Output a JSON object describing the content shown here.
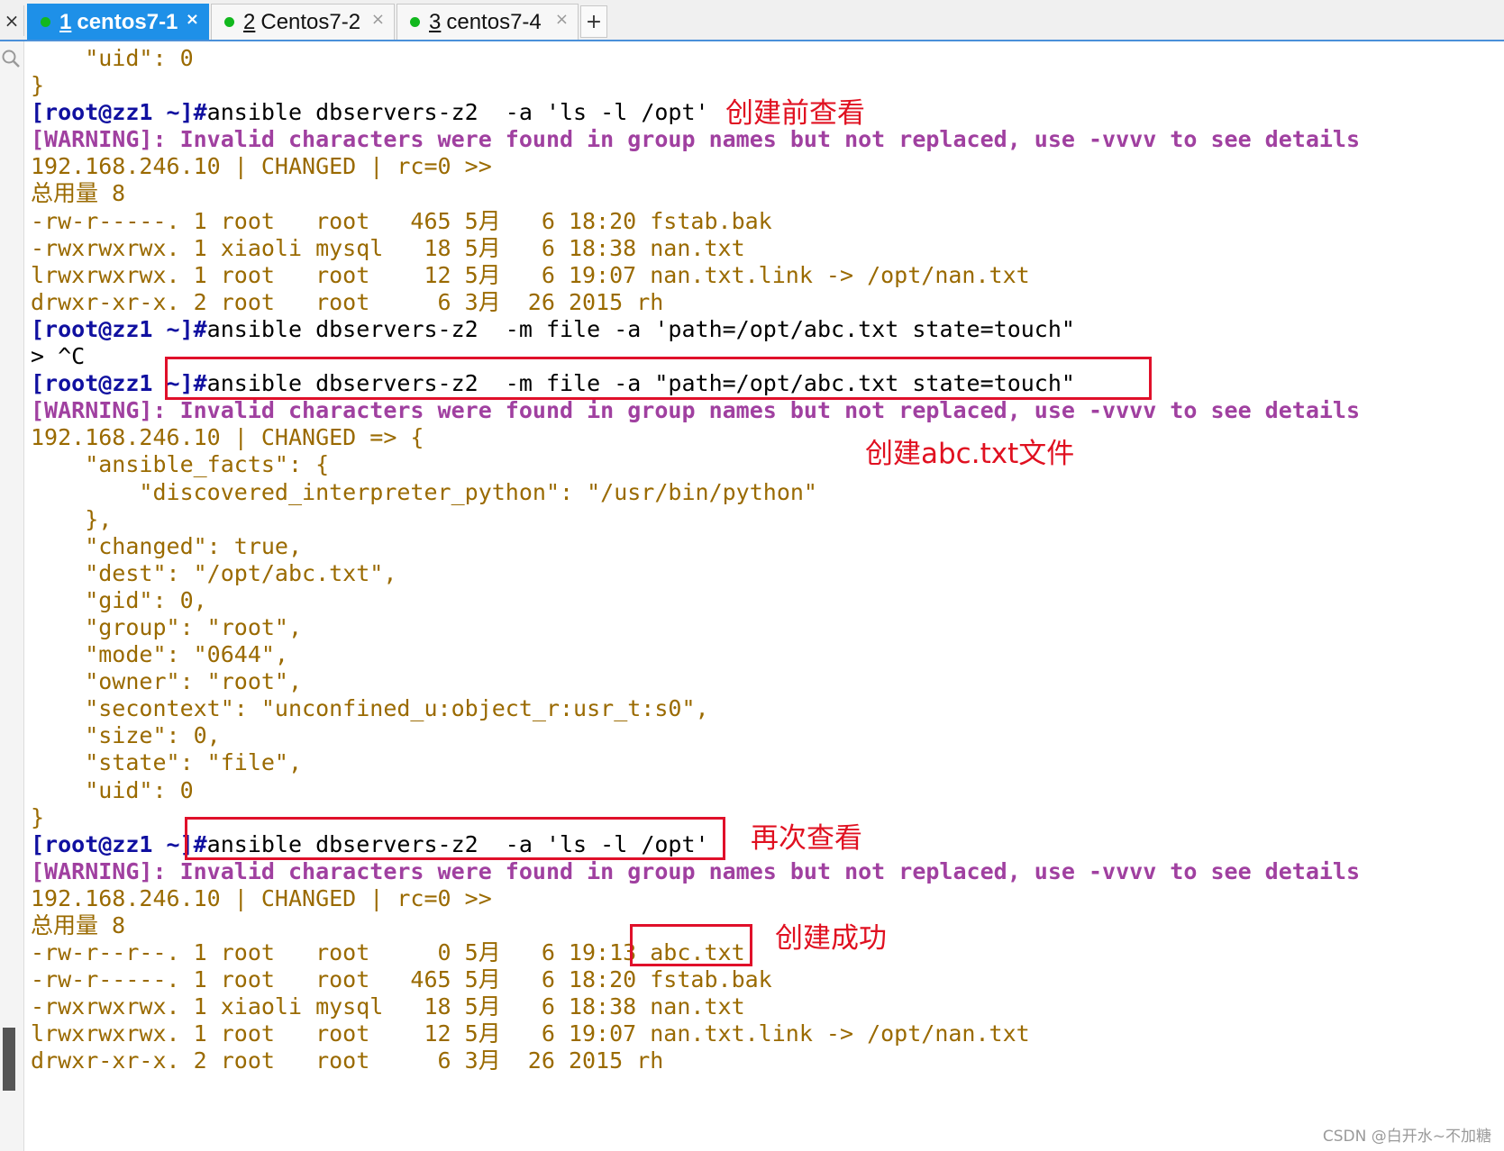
{
  "tabs": [
    {
      "num": "1",
      "label": "centos7-1",
      "active": true
    },
    {
      "num": "2",
      "label": "Centos7-2",
      "active": false
    },
    {
      "num": "3",
      "label": "centos7-4",
      "active": false
    }
  ],
  "tab_close_glyph": "×",
  "tab_add_glyph": "+",
  "left_close_glyph": "×",
  "colors": {
    "prompt": "#1010a0",
    "warning": "#a040a0",
    "output": "#9a6a00",
    "annotation": "#e0102a",
    "tab_active": "#1e90e8",
    "status_dot": "#12b81e"
  },
  "terminal": {
    "lines": [
      {
        "kind": "output",
        "text": "    \"uid\": 0"
      },
      {
        "kind": "output",
        "text": "}"
      },
      {
        "kind": "command",
        "prompt": "[root@zz1 ~]#",
        "text": "ansible dbservers-z2  -a 'ls -l /opt'"
      },
      {
        "kind": "warning",
        "text": "[WARNING]: Invalid characters were found in group names but not replaced, use -vvvv to see details"
      },
      {
        "kind": "output",
        "text": "192.168.246.10 | CHANGED | rc=0 >>"
      },
      {
        "kind": "output",
        "text": "总用量 8"
      },
      {
        "kind": "output",
        "text": "-rw-r-----. 1 root   root   465 5月   6 18:20 fstab.bak"
      },
      {
        "kind": "output",
        "text": "-rwxrwxrwx. 1 xiaoli mysql   18 5月   6 18:38 nan.txt"
      },
      {
        "kind": "output",
        "text": "lrwxrwxrwx. 1 root   root    12 5月   6 19:07 nan.txt.link -> /opt/nan.txt"
      },
      {
        "kind": "output",
        "text": "drwxr-xr-x. 2 root   root     6 3月  26 2015 rh"
      },
      {
        "kind": "command",
        "prompt": "[root@zz1 ~]#",
        "text": "ansible dbservers-z2  -m file -a 'path=/opt/abc.txt state=touch\""
      },
      {
        "kind": "plain",
        "text": "> ^C"
      },
      {
        "kind": "command",
        "prompt": "[root@zz1 ~]#",
        "text": "ansible dbservers-z2  -m file -a \"path=/opt/abc.txt state=touch\""
      },
      {
        "kind": "warning",
        "text": "[WARNING]: Invalid characters were found in group names but not replaced, use -vvvv to see details"
      },
      {
        "kind": "output",
        "text": "192.168.246.10 | CHANGED => {"
      },
      {
        "kind": "output",
        "text": "    \"ansible_facts\": {"
      },
      {
        "kind": "output",
        "text": "        \"discovered_interpreter_python\": \"/usr/bin/python\""
      },
      {
        "kind": "output",
        "text": "    },"
      },
      {
        "kind": "output",
        "text": "    \"changed\": true,"
      },
      {
        "kind": "output",
        "text": "    \"dest\": \"/opt/abc.txt\","
      },
      {
        "kind": "output",
        "text": "    \"gid\": 0,"
      },
      {
        "kind": "output",
        "text": "    \"group\": \"root\","
      },
      {
        "kind": "output",
        "text": "    \"mode\": \"0644\","
      },
      {
        "kind": "output",
        "text": "    \"owner\": \"root\","
      },
      {
        "kind": "output",
        "text": "    \"secontext\": \"unconfined_u:object_r:usr_t:s0\","
      },
      {
        "kind": "output",
        "text": "    \"size\": 0,"
      },
      {
        "kind": "output",
        "text": "    \"state\": \"file\","
      },
      {
        "kind": "output",
        "text": "    \"uid\": 0"
      },
      {
        "kind": "output",
        "text": "}"
      },
      {
        "kind": "command",
        "prompt": "[root@zz1 ~]#",
        "text": "ansible dbservers-z2  -a 'ls -l /opt'"
      },
      {
        "kind": "warning",
        "text": "[WARNING]: Invalid characters were found in group names but not replaced, use -vvvv to see details"
      },
      {
        "kind": "output",
        "text": "192.168.246.10 | CHANGED | rc=0 >>"
      },
      {
        "kind": "output",
        "text": "总用量 8"
      },
      {
        "kind": "output",
        "text": "-rw-r--r--. 1 root   root     0 5月   6 19:13 abc.txt"
      },
      {
        "kind": "output",
        "text": "-rw-r-----. 1 root   root   465 5月   6 18:20 fstab.bak"
      },
      {
        "kind": "output",
        "text": "-rwxrwxrwx. 1 xiaoli mysql   18 5月   6 18:38 nan.txt"
      },
      {
        "kind": "output",
        "text": "lrwxrwxrwx. 1 root   root    12 5月   6 19:07 nan.txt.link -> /opt/nan.txt"
      },
      {
        "kind": "output",
        "text": "drwxr-xr-x. 2 root   root     6 3月  26 2015 rh"
      }
    ]
  },
  "annotations": {
    "before_check": "创建前查看",
    "create_file": "创建abc.txt文件",
    "check_again": "再次查看",
    "success": "创建成功"
  },
  "watermark": "CSDN @白开水~不加糖"
}
